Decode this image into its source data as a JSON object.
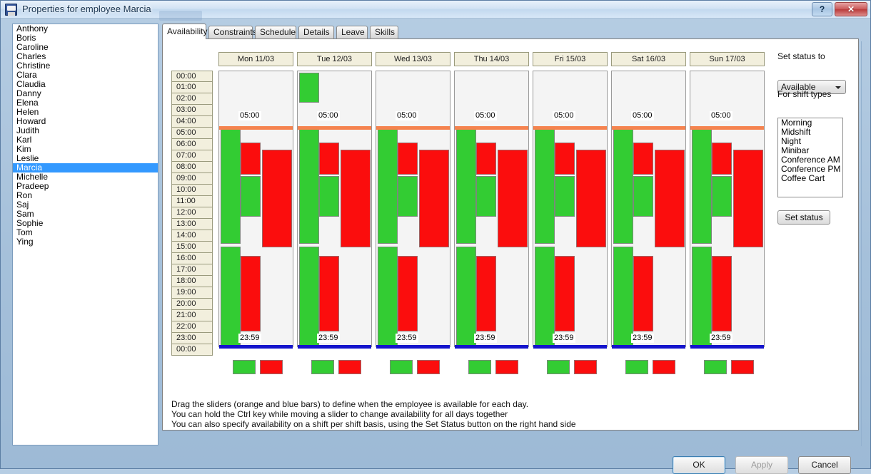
{
  "window": {
    "title": "Properties for employee Marcia",
    "icon": "employee-properties-icon",
    "help_label": "?",
    "close_label": "✕"
  },
  "employee_list": {
    "name": "employee-list",
    "selected": "Marcia",
    "items": [
      "Anthony",
      "Boris",
      "Caroline",
      "Charles",
      "Christine",
      "Clara",
      "Claudia",
      "Danny",
      "Elena",
      "Helen",
      "Howard",
      "Judith",
      "Karl",
      "Kim",
      "Leslie",
      "Marcia",
      "Michelle",
      "Pradeep",
      "Ron",
      "Saj",
      "Sam",
      "Sophie",
      "Tom",
      "Ying"
    ]
  },
  "tabs": {
    "active": "Availability",
    "items": [
      {
        "label": "Availability"
      },
      {
        "label": "Constraints"
      },
      {
        "label": "Schedule"
      },
      {
        "label": "Details"
      },
      {
        "label": "Leave"
      },
      {
        "label": "Skills"
      }
    ]
  },
  "availability": {
    "time_labels": [
      "00:00",
      "01:00",
      "02:00",
      "03:00",
      "04:00",
      "05:00",
      "06:00",
      "07:00",
      "08:00",
      "09:00",
      "10:00",
      "11:00",
      "12:00",
      "13:00",
      "14:00",
      "15:00",
      "16:00",
      "17:00",
      "18:00",
      "19:00",
      "20:00",
      "21:00",
      "22:00",
      "23:00",
      "00:00"
    ],
    "start_label": "05:00",
    "end_label": "23:59",
    "colors": {
      "available": "#33cc33",
      "unavailable": "#fb0d0d",
      "start_slider": "#f5834f",
      "end_slider": "#1414cc",
      "grid_background": "#f4f4f4",
      "header_background": "#f2efdd"
    },
    "days": [
      {
        "header": "Mon 11/03",
        "start": "05:00",
        "end": "23:59",
        "blocks": [
          {
            "type": "green",
            "lane": 0,
            "start_h": 5.0,
            "end_h": 15.0
          },
          {
            "type": "green",
            "lane": 0,
            "start_h": 15.2,
            "end_h": 23.98
          },
          {
            "type": "red",
            "lane": 1,
            "start_h": 6.2,
            "end_h": 9.0
          },
          {
            "type": "green",
            "lane": 1,
            "start_h": 9.1,
            "end_h": 12.6
          },
          {
            "type": "red",
            "lane": 1,
            "start_h": 16.0,
            "end_h": 22.6
          },
          {
            "type": "red",
            "lane": 2,
            "start_h": 6.8,
            "end_h": 15.3
          }
        ],
        "swatches": [
          "green",
          "red"
        ]
      },
      {
        "header": "Tue 12/03",
        "start": "05:00",
        "end": "23:59",
        "blocks": [
          {
            "type": "green",
            "lane": 0,
            "start_h": 0.15,
            "end_h": 2.7
          },
          {
            "type": "green",
            "lane": 0,
            "start_h": 5.0,
            "end_h": 15.0
          },
          {
            "type": "green",
            "lane": 0,
            "start_h": 15.2,
            "end_h": 23.98
          },
          {
            "type": "red",
            "lane": 1,
            "start_h": 6.2,
            "end_h": 9.0
          },
          {
            "type": "green",
            "lane": 1,
            "start_h": 9.1,
            "end_h": 12.6
          },
          {
            "type": "red",
            "lane": 1,
            "start_h": 16.0,
            "end_h": 22.6
          },
          {
            "type": "red",
            "lane": 2,
            "start_h": 6.8,
            "end_h": 15.3
          }
        ],
        "swatches": [
          "green",
          "red"
        ]
      },
      {
        "header": "Wed 13/03",
        "start": "05:00",
        "end": "23:59",
        "blocks": [
          {
            "type": "green",
            "lane": 0,
            "start_h": 5.0,
            "end_h": 15.0
          },
          {
            "type": "green",
            "lane": 0,
            "start_h": 15.2,
            "end_h": 23.98
          },
          {
            "type": "red",
            "lane": 1,
            "start_h": 6.2,
            "end_h": 9.0
          },
          {
            "type": "green",
            "lane": 1,
            "start_h": 9.1,
            "end_h": 12.6
          },
          {
            "type": "red",
            "lane": 1,
            "start_h": 16.0,
            "end_h": 22.6
          },
          {
            "type": "red",
            "lane": 2,
            "start_h": 6.8,
            "end_h": 15.3
          }
        ],
        "swatches": [
          "green",
          "red"
        ]
      },
      {
        "header": "Thu 14/03",
        "start": "05:00",
        "end": "23:59",
        "blocks": [
          {
            "type": "green",
            "lane": 0,
            "start_h": 5.0,
            "end_h": 15.0
          },
          {
            "type": "green",
            "lane": 0,
            "start_h": 15.2,
            "end_h": 23.98
          },
          {
            "type": "red",
            "lane": 1,
            "start_h": 6.2,
            "end_h": 9.0
          },
          {
            "type": "green",
            "lane": 1,
            "start_h": 9.1,
            "end_h": 12.6
          },
          {
            "type": "red",
            "lane": 1,
            "start_h": 16.0,
            "end_h": 22.6
          },
          {
            "type": "red",
            "lane": 2,
            "start_h": 6.8,
            "end_h": 15.3
          }
        ],
        "swatches": [
          "green",
          "red"
        ]
      },
      {
        "header": "Fri 15/03",
        "start": "05:00",
        "end": "23:59",
        "blocks": [
          {
            "type": "green",
            "lane": 0,
            "start_h": 5.0,
            "end_h": 15.0
          },
          {
            "type": "green",
            "lane": 0,
            "start_h": 15.2,
            "end_h": 23.98
          },
          {
            "type": "red",
            "lane": 1,
            "start_h": 6.2,
            "end_h": 9.0
          },
          {
            "type": "green",
            "lane": 1,
            "start_h": 9.1,
            "end_h": 12.6
          },
          {
            "type": "red",
            "lane": 1,
            "start_h": 16.0,
            "end_h": 22.6
          },
          {
            "type": "red",
            "lane": 2,
            "start_h": 6.8,
            "end_h": 15.3
          }
        ],
        "swatches": [
          "green",
          "red"
        ]
      },
      {
        "header": "Sat 16/03",
        "start": "05:00",
        "end": "23:59",
        "blocks": [
          {
            "type": "green",
            "lane": 0,
            "start_h": 5.0,
            "end_h": 15.0
          },
          {
            "type": "green",
            "lane": 0,
            "start_h": 15.2,
            "end_h": 23.98
          },
          {
            "type": "red",
            "lane": 1,
            "start_h": 6.2,
            "end_h": 9.0
          },
          {
            "type": "green",
            "lane": 1,
            "start_h": 9.1,
            "end_h": 12.6
          },
          {
            "type": "red",
            "lane": 1,
            "start_h": 16.0,
            "end_h": 22.6
          },
          {
            "type": "red",
            "lane": 2,
            "start_h": 6.8,
            "end_h": 15.3
          }
        ],
        "swatches": [
          "green",
          "red"
        ]
      },
      {
        "header": "Sun 17/03",
        "start": "05:00",
        "end": "23:59",
        "blocks": [
          {
            "type": "green",
            "lane": 0,
            "start_h": 5.0,
            "end_h": 15.0
          },
          {
            "type": "green",
            "lane": 0,
            "start_h": 15.2,
            "end_h": 23.98
          },
          {
            "type": "red",
            "lane": 1,
            "start_h": 6.2,
            "end_h": 9.0
          },
          {
            "type": "green",
            "lane": 1,
            "start_h": 9.1,
            "end_h": 12.6
          },
          {
            "type": "red",
            "lane": 1,
            "start_h": 16.0,
            "end_h": 22.6
          },
          {
            "type": "red",
            "lane": 2,
            "start_h": 6.8,
            "end_h": 15.3
          }
        ],
        "swatches": [
          "green",
          "red"
        ]
      }
    ],
    "hints": [
      "Drag the sliders (orange and blue bars) to define when the employee is available for each day.",
      "You can hold the Ctrl key while moving a slider to change availability for all days together",
      "You can also specify availability on a shift per shift basis, using the Set Status button on the right hand side"
    ]
  },
  "right_panel": {
    "set_status_to_label": "Set status to",
    "status_value": "Available",
    "for_shift_types_label": "For shift types",
    "shift_types": [
      "Morning",
      "Midshift",
      "Night",
      "Minibar",
      "Conference AM",
      "Conference PM",
      "Coffee Cart"
    ],
    "set_status_button": "Set status"
  },
  "footer": {
    "ok": "OK",
    "apply": "Apply",
    "cancel": "Cancel"
  }
}
